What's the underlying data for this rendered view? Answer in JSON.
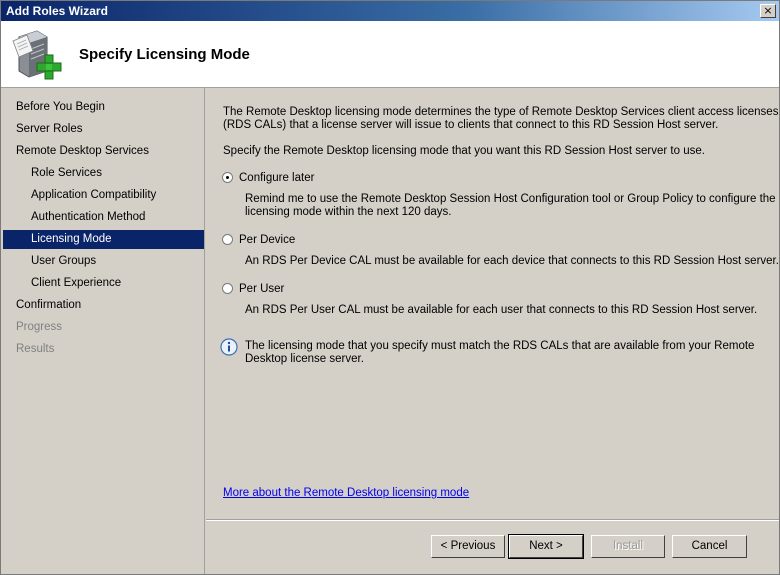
{
  "window": {
    "title": "Add Roles Wizard",
    "close_glyph": "×"
  },
  "header": {
    "title": "Specify Licensing Mode",
    "icon": "server-add-icon"
  },
  "sidebar": {
    "items": [
      {
        "label": "Before You Begin",
        "state": "normal"
      },
      {
        "label": "Server Roles",
        "state": "normal"
      },
      {
        "label": "Remote Desktop Services",
        "state": "normal"
      },
      {
        "label": "Role Services",
        "state": "normal"
      },
      {
        "label": "Application Compatibility",
        "state": "normal"
      },
      {
        "label": "Authentication Method",
        "state": "normal"
      },
      {
        "label": "Licensing Mode",
        "state": "active"
      },
      {
        "label": "User Groups",
        "state": "normal"
      },
      {
        "label": "Client Experience",
        "state": "normal"
      },
      {
        "label": "Confirmation",
        "state": "normal"
      },
      {
        "label": "Progress",
        "state": "disabled"
      },
      {
        "label": "Results",
        "state": "disabled"
      }
    ]
  },
  "content": {
    "intro_line1": "The Remote Desktop licensing mode determines the type of Remote Desktop Services client access licenses",
    "intro_line2": "(RDS CALs) that a license server will issue to clients that connect to this RD Session Host server.",
    "specify_text": "Specify the Remote Desktop licensing mode that you want this RD Session Host server to use.",
    "options": [
      {
        "label": "Configure later",
        "selected": true,
        "desc_line1": "Remind me to use the Remote Desktop Session Host Configuration tool or Group Policy to configure the",
        "desc_line2": "licensing mode within the next 120 days."
      },
      {
        "label": "Per Device",
        "selected": false,
        "desc_line1": "An RDS Per Device CAL must be available for each device that connects to this RD Session Host server.",
        "desc_line2": ""
      },
      {
        "label": "Per User",
        "selected": false,
        "desc_line1": "An RDS Per User CAL must be available for each user that connects to this RD Session Host server.",
        "desc_line2": ""
      }
    ],
    "info_line1": "The licensing mode that you specify must match the RDS CALs that are available from your Remote",
    "info_line2": "Desktop license server.",
    "more_link": "More about the Remote Desktop licensing mode"
  },
  "buttons": {
    "previous": "< Previous",
    "next": "Next >",
    "install": "Install",
    "cancel": "Cancel"
  },
  "colors": {
    "selection": "#0a246a",
    "link": "#0000ee",
    "face": "#d4d0c8"
  }
}
